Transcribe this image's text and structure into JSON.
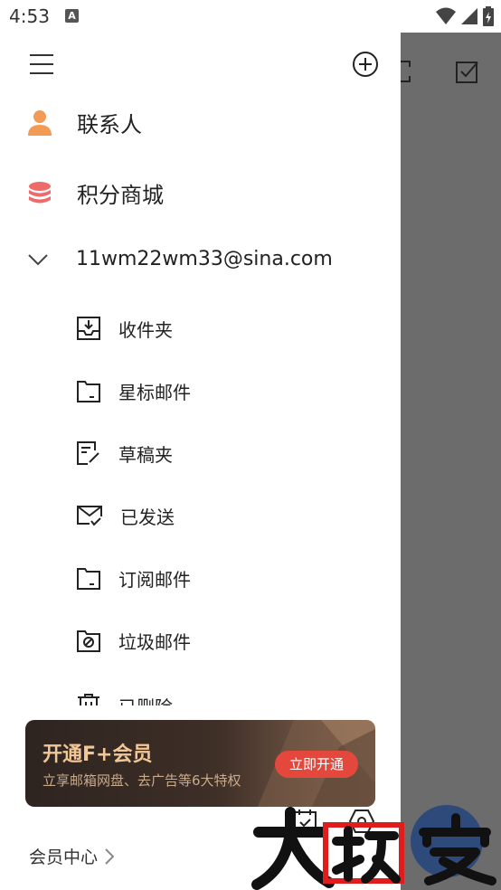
{
  "status_bar": {
    "time": "4:53",
    "notification_glyph": "A"
  },
  "nav": {
    "contacts": "联系人",
    "points_mall": "积分商城"
  },
  "account": {
    "email": "11wm22wm33@sina.com"
  },
  "folders": [
    "收件夹",
    "星标邮件",
    "草稿夹",
    "已发送",
    "订阅邮件",
    "垃圾邮件",
    "已删除"
  ],
  "vip": {
    "title": "开通F+会员",
    "subtitle": "立享邮箱网盘、去广告等6大特权",
    "button": "立即开通"
  },
  "footer": {
    "member_center": "会员中心"
  },
  "colors": {
    "contact_icon": "#f39a54",
    "points_icon": "#ef6a6a",
    "vip_button": "#e4483d",
    "overlay": "#6c6c6c"
  }
}
